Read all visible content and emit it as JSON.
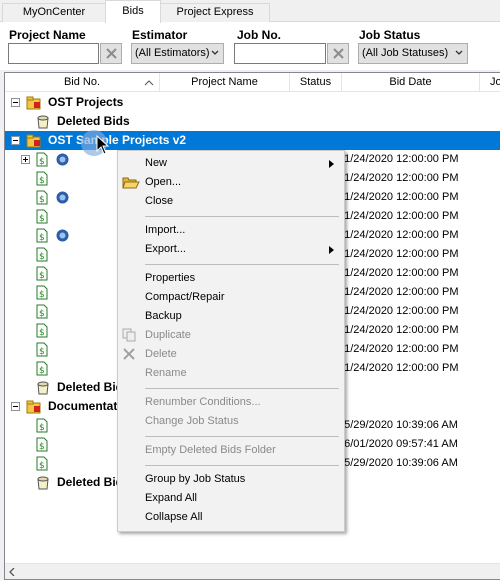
{
  "tabs": [
    {
      "label": "MyOnCenter",
      "active": false
    },
    {
      "label": "Bids",
      "active": true
    },
    {
      "label": "Project Express",
      "active": false
    }
  ],
  "filters": {
    "project_name_label": "Project Name",
    "project_name_value": "",
    "estimator_label": "Estimator",
    "estimator_value": "(All Estimators)",
    "job_no_label": "Job No.",
    "job_no_value": "",
    "job_status_label": "Job Status",
    "job_status_value": "(All Job Statuses)"
  },
  "columns": [
    "Bid No.",
    "Project Name",
    "Status",
    "Bid Date",
    "Jo"
  ],
  "groups": {
    "ost_projects": "OST Projects",
    "deleted_bids": "Deleted Bids",
    "ost_sample": "OST Sample Projects v2",
    "documentation": "Documentation"
  },
  "dates": [
    "01/24/2020 12:00:00 PM",
    "01/24/2020 12:00:00 PM",
    "01/24/2020 12:00:00 PM",
    "01/24/2020 12:00:00 PM",
    "01/24/2020 12:00:00 PM",
    "01/24/2020 12:00:00 PM",
    "01/24/2020 12:00:00 PM",
    "01/24/2020 12:00:00 PM",
    "01/24/2020 12:00:00 PM",
    "01/24/2020 12:00:00 PM",
    "01/24/2020 12:00:00 PM",
    "01/24/2020 12:00:00 PM",
    "05/29/2020 10:39:06 AM",
    "06/01/2020 09:57:41 AM",
    "05/29/2020 10:39:06 AM"
  ],
  "menu": {
    "new": "New",
    "open": "Open...",
    "close": "Close",
    "import": "Import...",
    "export": "Export...",
    "properties": "Properties",
    "compact": "Compact/Repair",
    "backup": "Backup",
    "duplicate": "Duplicate",
    "delete": "Delete",
    "rename": "Rename",
    "renumber": "Renumber Conditions...",
    "change_status": "Change Job Status",
    "empty_deleted": "Empty Deleted Bids Folder",
    "group_by_status": "Group by Job Status",
    "expand_all": "Expand All",
    "collapse_all": "Collapse All"
  }
}
